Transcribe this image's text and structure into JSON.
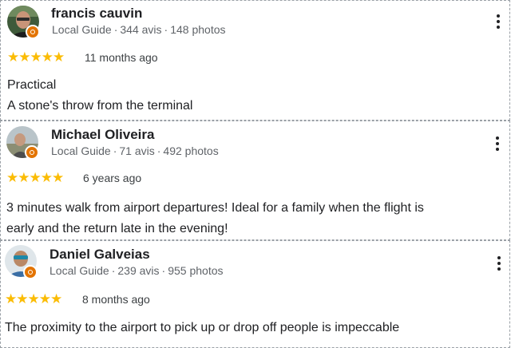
{
  "colors": {
    "star": "#fbbc04",
    "badge": "#e37400",
    "meta_text": "#5f6368"
  },
  "reviews": [
    {
      "author": "francis cauvin",
      "guide_label": "Local Guide",
      "reviews_count": "344 avis",
      "photos_count": "148 photos",
      "rating": 5,
      "stars": "★★★★★",
      "time_ago": "11 months ago",
      "text_lines": [
        "Practical",
        "A stone's throw from the terminal"
      ],
      "menu_icon": "more-vert-icon",
      "badge_icon": "local-guide-badge-icon"
    },
    {
      "author": "Michael Oliveira",
      "guide_label": "Local Guide",
      "reviews_count": "71 avis",
      "photos_count": "492 photos",
      "rating": 5,
      "stars": "★★★★★",
      "time_ago": "6 years ago",
      "text_lines": [
        "3 minutes walk from airport departures! Ideal for a family when the flight is",
        "early and the return late in the evening!"
      ],
      "menu_icon": "more-vert-icon",
      "badge_icon": "local-guide-badge-icon"
    },
    {
      "author": "Daniel Galveias",
      "guide_label": "Local Guide",
      "reviews_count": "239 avis",
      "photos_count": "955 photos",
      "rating": 5,
      "stars": "★★★★★",
      "time_ago": "8 months ago",
      "text_lines": [
        "The proximity to the airport to pick up or drop off people is impeccable"
      ],
      "menu_icon": "more-vert-icon",
      "badge_icon": "local-guide-badge-icon"
    }
  ]
}
